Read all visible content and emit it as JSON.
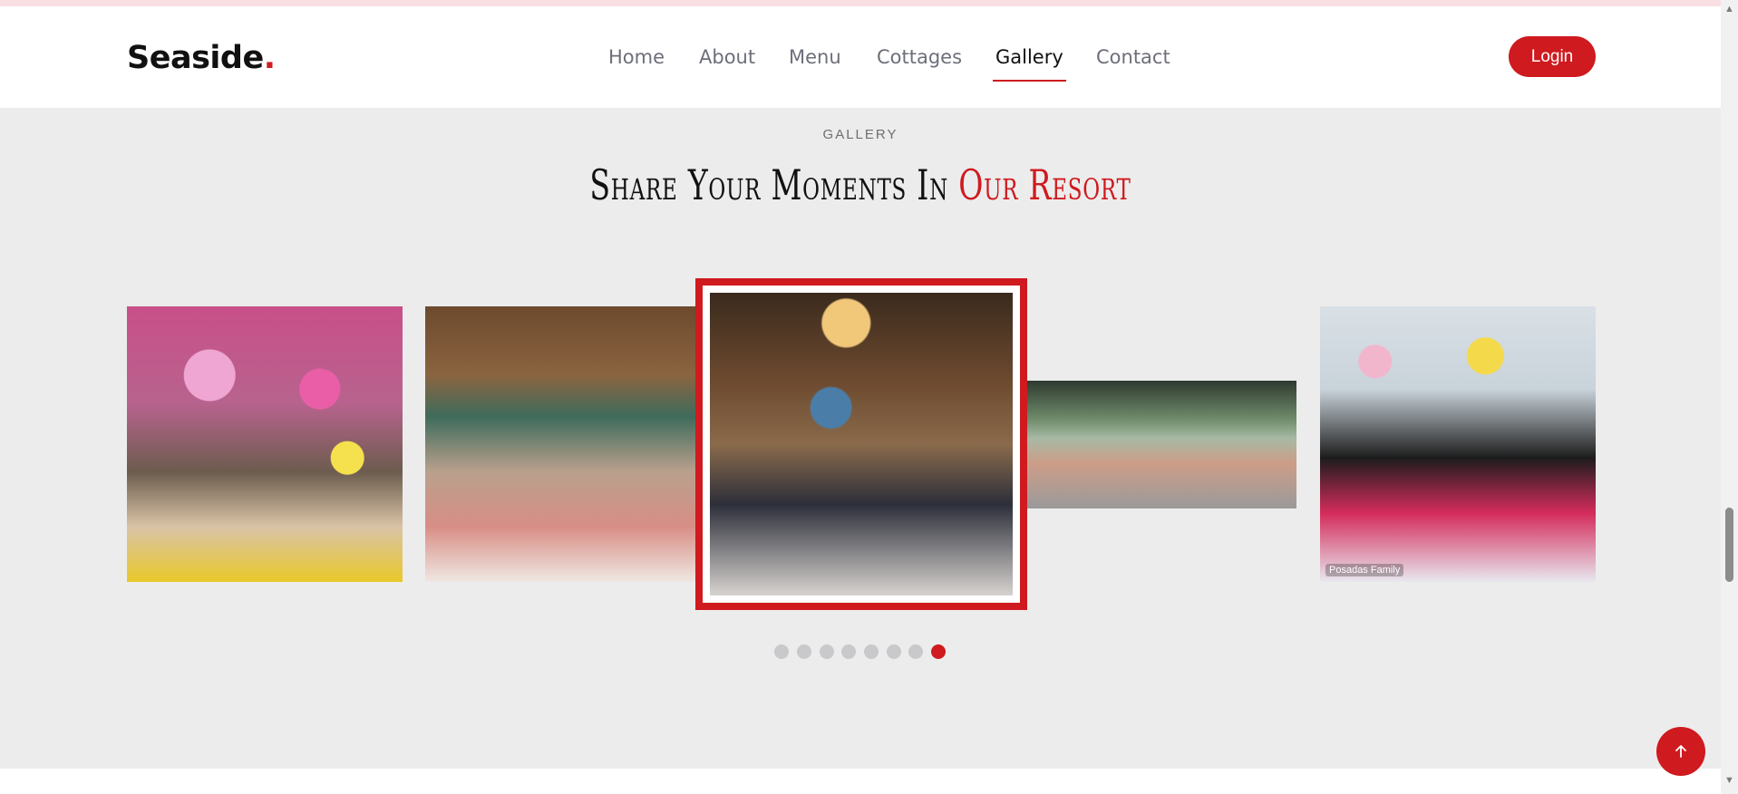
{
  "header": {
    "logo_text": "Seaside",
    "logo_dot": ".",
    "nav": [
      "Home",
      "About",
      "Menu",
      "Cottages",
      "Gallery",
      "Contact"
    ],
    "active_nav": "Gallery",
    "login_label": "Login"
  },
  "gallery": {
    "eyebrow": "GALLERY",
    "title_main": "Share Your Moments In ",
    "title_accent": "Our Resort",
    "photo_5_text": "Posadas Family",
    "slider_dots": 8,
    "active_dot_index": 7
  },
  "colors": {
    "accent": "#cf1a1f",
    "section_bg": "#ececec"
  },
  "icons": {
    "back_to_top": "arrow-up-icon",
    "scroll_up": "triangle-up-icon",
    "scroll_down": "triangle-down-icon"
  }
}
